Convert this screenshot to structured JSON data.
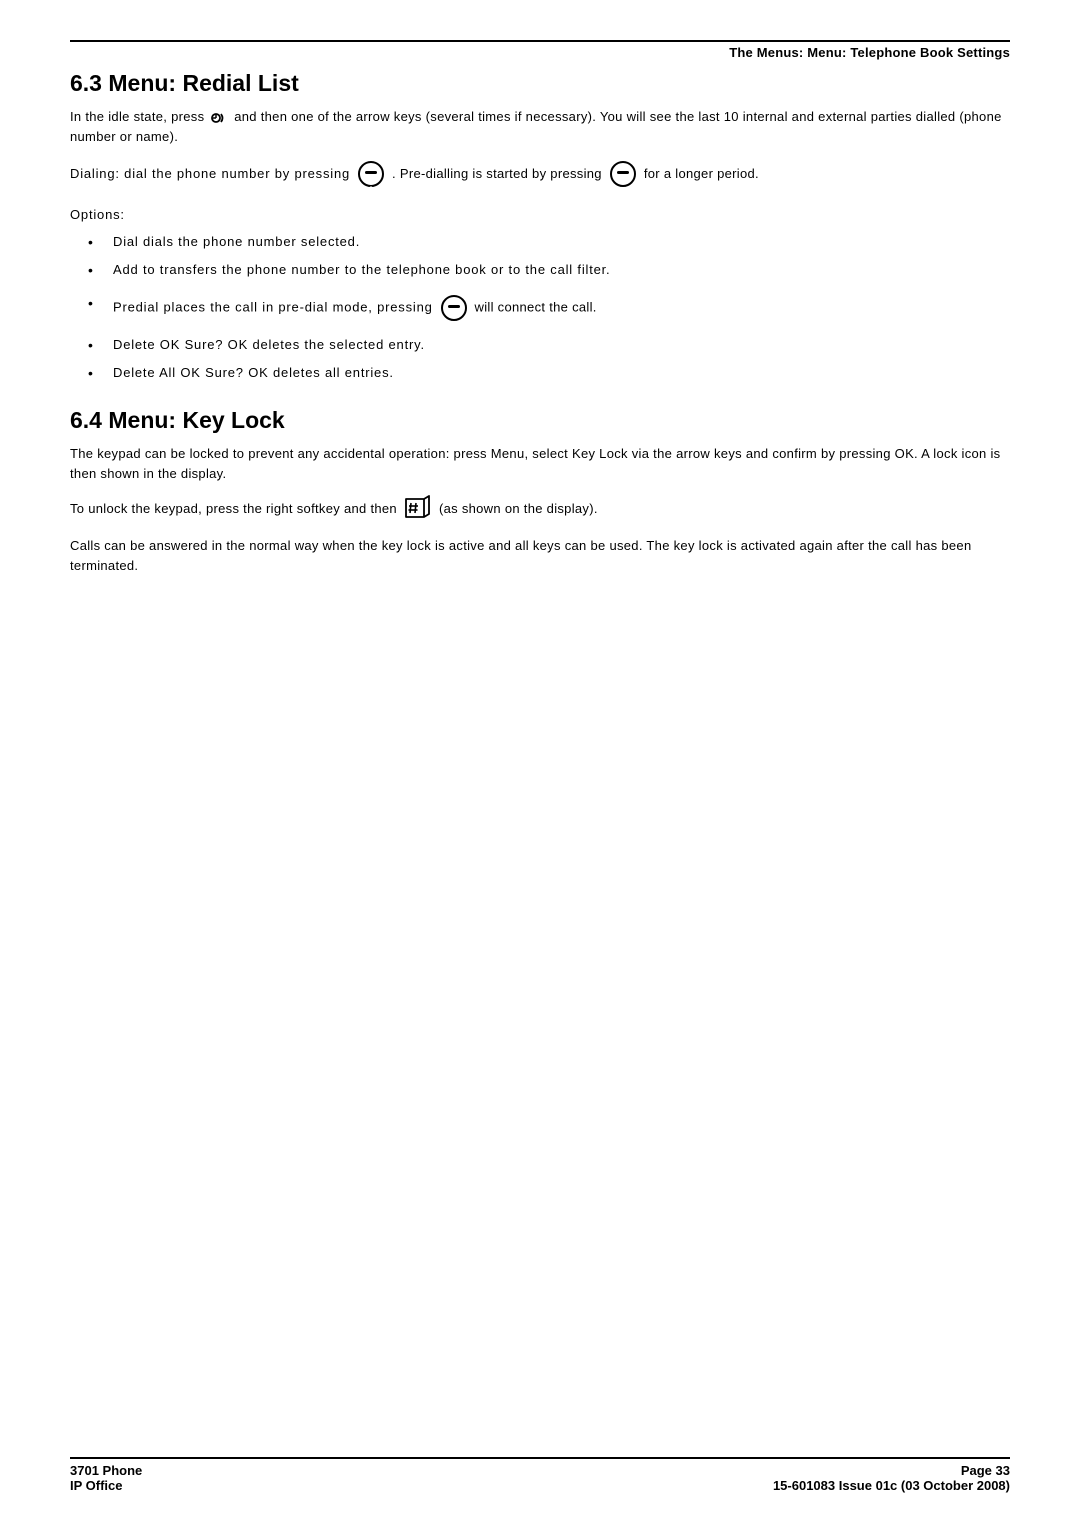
{
  "header": {
    "breadcrumb": "The Menus: Menu: Telephone Book Settings"
  },
  "section63": {
    "heading": "6.3 Menu: Redial List",
    "p1": "In the idle state, press",
    "p1b": "and then one of the arrow keys (several times if necessary). You will see the last 10 internal and external parties dialled (phone number or name).",
    "p2a": "Dialing: dial the phone number by pressing",
    "p2b": ". Pre-dialling is started by pressing",
    "p2c": "for a longer period.",
    "options_label": "Options:",
    "bullets": [
      "Dial dials the phone number selected.",
      "Add to transfers the phone number to the telephone book or to the call filter.",
      {
        "pre": "Predial places the call in pre-dial mode, pressing",
        "post": "will connect the call."
      },
      "Delete OK Sure? OK deletes the selected entry.",
      "Delete All OK Sure? OK deletes all entries."
    ]
  },
  "section64": {
    "heading": "6.4 Menu: Key Lock",
    "p1": "The keypad can be locked to prevent any accidental operation: press Menu, select Key Lock via the arrow keys and confirm by pressing OK. A lock icon is then shown in the display.",
    "p2a": "To unlock the keypad, press the right softkey and then",
    "p2b": "(as shown on the display).",
    "p3": "Calls can be answered in the normal way when the key lock is active and all keys can be used. The key lock is activated again after the call has been terminated."
  },
  "footer": {
    "left1": "3701 Phone",
    "right1": "Page 33",
    "left2": "IP Office",
    "right2": "15-601083 Issue 01c (03 October 2008)"
  }
}
